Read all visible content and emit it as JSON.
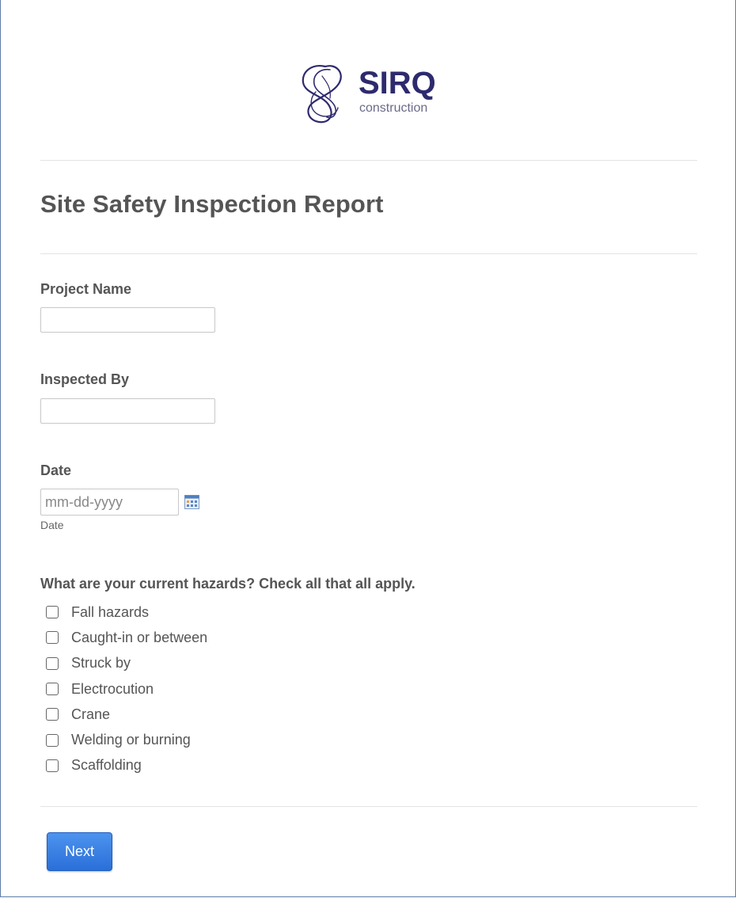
{
  "logo": {
    "brand": "SIRQ",
    "tagline": "construction",
    "icon": "sirq-swirl-logo",
    "color": "#2e2a6e"
  },
  "form": {
    "title": "Site Safety Inspection Report",
    "fields": {
      "project_name": {
        "label": "Project Name",
        "value": "",
        "placeholder": ""
      },
      "inspected_by": {
        "label": "Inspected By",
        "value": "",
        "placeholder": ""
      },
      "date": {
        "label": "Date",
        "value": "",
        "placeholder": "mm-dd-yyyy",
        "sublabel": "Date",
        "icon": "calendar-icon"
      }
    },
    "hazards": {
      "question": "What are your current hazards? Check all that all apply.",
      "options": [
        {
          "label": "Fall hazards",
          "checked": false
        },
        {
          "label": "Caught-in or between",
          "checked": false
        },
        {
          "label": "Struck by",
          "checked": false
        },
        {
          "label": "Electrocution",
          "checked": false
        },
        {
          "label": "Crane",
          "checked": false
        },
        {
          "label": "Welding or burning",
          "checked": false
        },
        {
          "label": "Scaffolding",
          "checked": false
        }
      ]
    },
    "next_label": "Next"
  },
  "colors": {
    "text": "#555555",
    "button": "#2f74dc",
    "divider": "#e3e3e3",
    "frame": "#5b7da6"
  }
}
